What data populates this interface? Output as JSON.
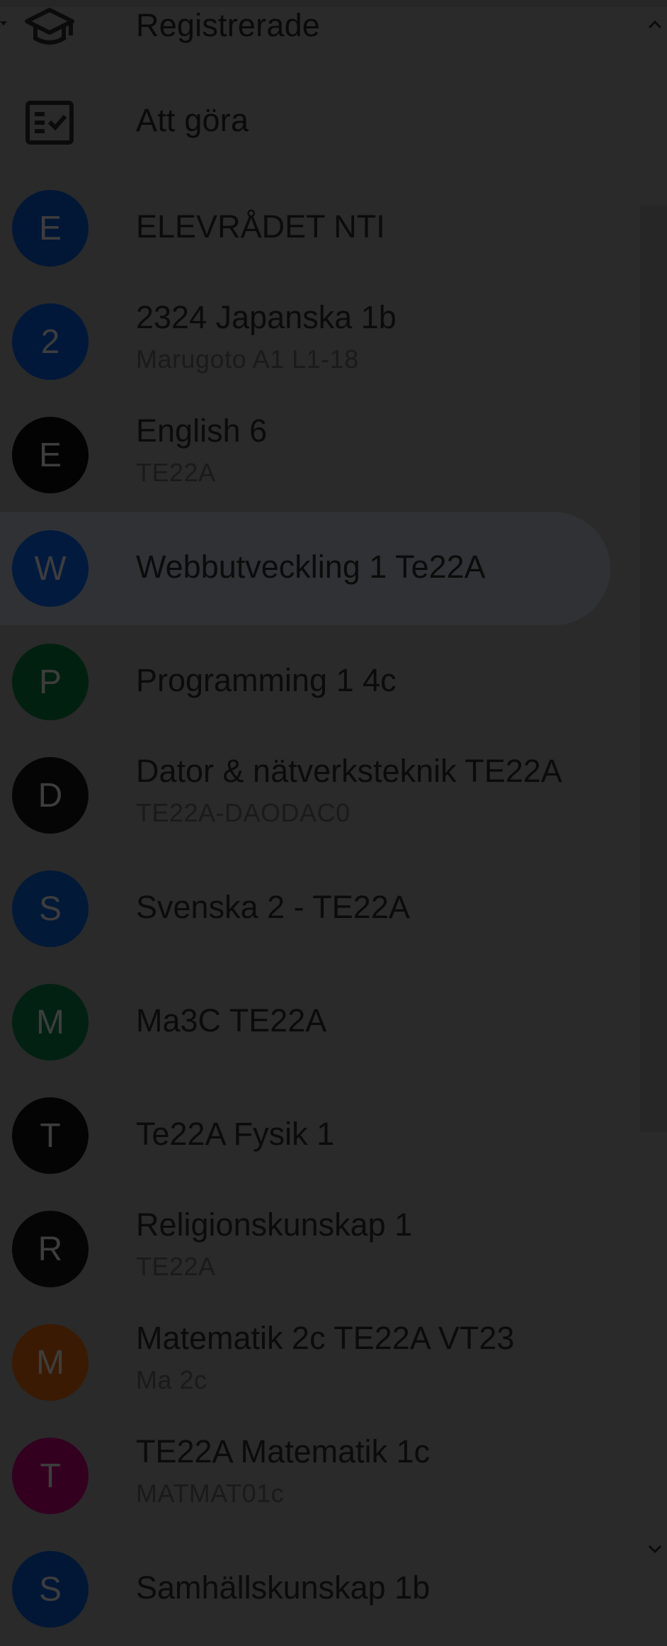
{
  "nav": {
    "enrolled_label": "Registrerade",
    "todo_label": "Att göra"
  },
  "courses": [
    {
      "initial": "E",
      "title": "ELEVRÅDET NTI",
      "subtitle": "",
      "color": "#021736"
    },
    {
      "initial": "2",
      "title": "2324 Japanska 1b",
      "subtitle": "Marugoto A1 L1-18",
      "color": "#02183a"
    },
    {
      "initial": "E",
      "title": "English 6",
      "subtitle": "TE22A",
      "color": "#030303"
    },
    {
      "initial": "W",
      "title": "Webbutveckling 1 Te22A",
      "subtitle": "",
      "color": "#021a3d"
    },
    {
      "initial": "P",
      "title": "Programming 1 4c",
      "subtitle": "",
      "color": "#02200f"
    },
    {
      "initial": "D",
      "title": "Dator & nätverksteknik TE22A",
      "subtitle": "TE22A-DAODAC0",
      "color": "#050505"
    },
    {
      "initial": "S",
      "title": "Svenska 2 - TE22A",
      "subtitle": "",
      "color": "#021938"
    },
    {
      "initial": "M",
      "title": "Ma3C TE22A",
      "subtitle": "",
      "color": "#022112"
    },
    {
      "initial": "T",
      "title": "Te22A Fysik 1",
      "subtitle": "",
      "color": "#040404"
    },
    {
      "initial": "R",
      "title": "Religionskunskap 1",
      "subtitle": "TE22A",
      "color": "#050505"
    },
    {
      "initial": "M",
      "title": "Matematik 2c TE22A VT23",
      "subtitle": "Ma 2c",
      "color": "#3a1a02"
    },
    {
      "initial": "T",
      "title": "TE22A Matematik 1c",
      "subtitle": "MATMAT01c",
      "color": "#33001f"
    },
    {
      "initial": "S",
      "title": "Samhällskunskap 1b",
      "subtitle": "",
      "color": "#021736"
    }
  ]
}
